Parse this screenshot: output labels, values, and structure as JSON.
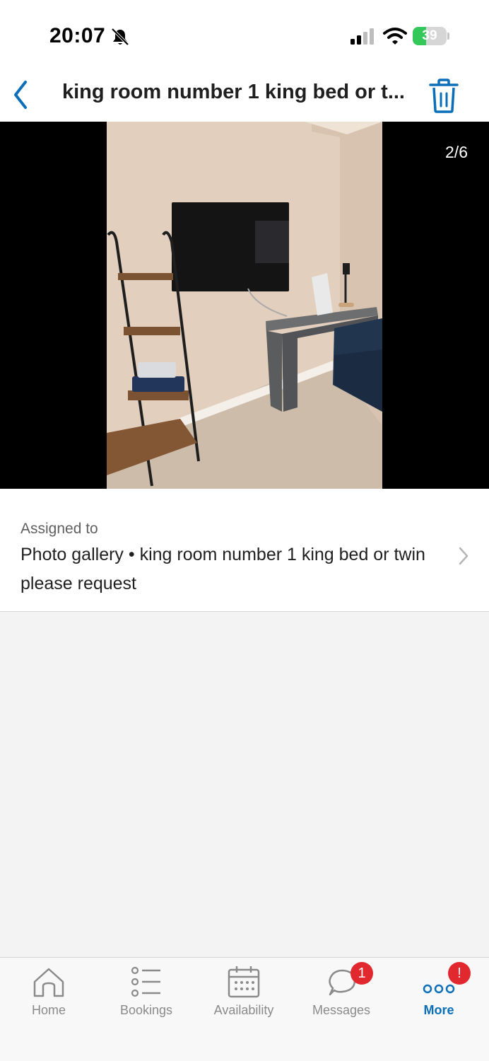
{
  "status_bar": {
    "time": "20:07",
    "battery_level": "39",
    "battery_fraction": 0.39
  },
  "nav": {
    "title": "king room number 1 king bed or t...",
    "back_icon": "chevron-left-icon",
    "delete_icon": "trash-icon"
  },
  "photo": {
    "counter": "2/6",
    "current": 2,
    "total": 6
  },
  "assignment": {
    "label": "Assigned to",
    "value": "Photo gallery • king room number 1 king bed or twin please request"
  },
  "tabs": [
    {
      "label": "Home",
      "icon": "home-icon",
      "active": false,
      "badge": ""
    },
    {
      "label": "Bookings",
      "icon": "list-icon",
      "active": false,
      "badge": ""
    },
    {
      "label": "Availability",
      "icon": "calendar-icon",
      "active": false,
      "badge": ""
    },
    {
      "label": "Messages",
      "icon": "chat-bubble-icon",
      "active": false,
      "badge": "1"
    },
    {
      "label": "More",
      "icon": "more-dots-icon",
      "active": true,
      "badge": "!"
    }
  ],
  "colors": {
    "accent": "#0a6fb8",
    "badge": "#e0282e",
    "battery": "#34c759",
    "inactive_tab": "#8a8a8a"
  }
}
